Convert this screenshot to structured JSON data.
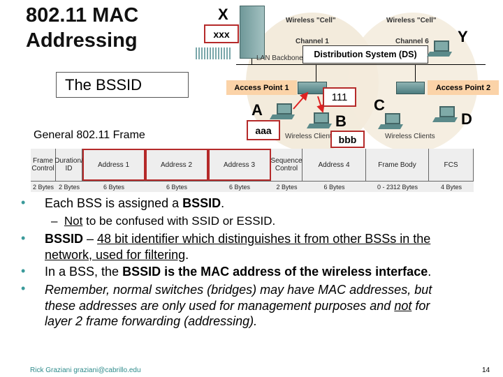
{
  "slide": {
    "title_line1": "802.11 MAC",
    "title_line2": "Addressing",
    "subtitle_box": "The BSSID",
    "frame_label": "General 802.11 Frame",
    "footer": "Rick Graziani  graziani@cabrillo.edu",
    "page_number": "14"
  },
  "diagram": {
    "cell_left": "Wireless \"Cell\"",
    "cell_right": "Wireless \"Cell\"",
    "channel_left": "Channel 1",
    "channel_right": "Channel 6",
    "lan_backbone": "LAN Backbone",
    "ds": "Distribution System (DS)",
    "ap1": "Access Point 1",
    "ap2": "Access Point 2",
    "clients_left": "Wireless Clients",
    "clients_right": "Wireless Clients",
    "letters": {
      "x": "X",
      "y": "Y",
      "a": "A",
      "b": "B",
      "c": "C",
      "d": "D"
    },
    "addresses": {
      "x": "xxx",
      "ap1": "111",
      "a": "aaa",
      "b": "bbb"
    },
    "highlight_color": "#b52a2a",
    "ap_label_color": "#fbd3a8"
  },
  "frame": {
    "fields": [
      {
        "name": "Frame Control",
        "size": "2 Bytes"
      },
      {
        "name": "Duration/ ID",
        "size": "2 Bytes"
      },
      {
        "name": "Address 1",
        "size": "6 Bytes"
      },
      {
        "name": "Address 2",
        "size": "6 Bytes"
      },
      {
        "name": "Address 3",
        "size": "6 Bytes"
      },
      {
        "name": "Sequence Control",
        "size": "2 Bytes"
      },
      {
        "name": "Address 4",
        "size": "6 Bytes"
      },
      {
        "name": "Frame Body",
        "size": "0 - 2312 Bytes"
      },
      {
        "name": "FCS",
        "size": "4 Bytes"
      }
    ]
  },
  "bullets": {
    "b1_pre": "Each BSS is assigned a ",
    "b1_bold": "BSSID",
    "b1_post": ".",
    "sub1_u": "Not",
    "sub1_post": " to be confused with SSID or ESSID.",
    "b2_bold": "BSSID",
    "b2_mid": " – ",
    "b2_u1": "48 bit identifier which distinguishes it from other BSSs in the",
    "b2_u2": "network, used for filtering",
    "b2_post": ".",
    "b3_pre": "In a BSS, the ",
    "b3_bold": "BSSID is the MAC address of the wireless interface",
    "b3_post": ".",
    "b4_l1": "Remember, normal switches (bridges) may have MAC addresses, but",
    "b4_l2_pre": "these addresses are only used for management purposes and ",
    "b4_l2_u": "not",
    "b4_l2_post": " for",
    "b4_l3": "layer 2 frame forwarding (addressing)."
  }
}
